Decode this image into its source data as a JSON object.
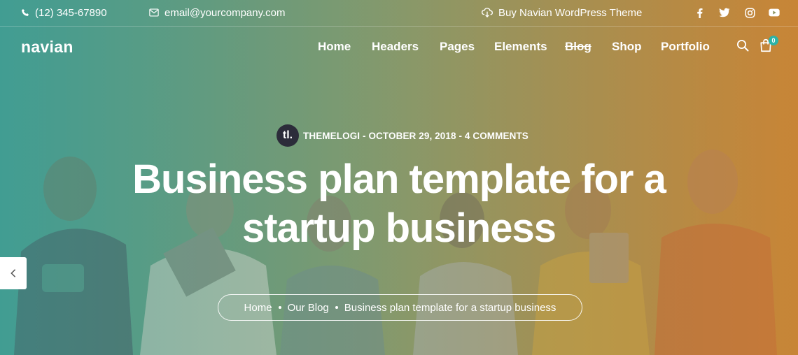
{
  "topbar": {
    "phone": "(12) 345-67890",
    "email": "email@yourcompany.com",
    "buy_link": "Buy Navian WordPress Theme",
    "social": [
      "facebook-icon",
      "twitter-icon",
      "instagram-icon",
      "youtube-icon"
    ]
  },
  "brand": {
    "logo": "navian"
  },
  "nav": {
    "items": [
      {
        "label": "Home"
      },
      {
        "label": "Headers"
      },
      {
        "label": "Pages"
      },
      {
        "label": "Elements"
      },
      {
        "label": "Blog"
      },
      {
        "label": "Shop"
      },
      {
        "label": "Portfolio"
      }
    ],
    "cart_count": "0"
  },
  "post": {
    "avatar_initials": "tl.",
    "meta": "THEMELOGI - OCTOBER 29, 2018 - 4 COMMENTS",
    "title_line1": "Business plan template for a",
    "title_line2": "startup business"
  },
  "breadcrumb": {
    "items": [
      "Home",
      "Our Blog",
      "Business plan template for a startup business"
    ]
  },
  "colors": {
    "gradient_left": "#3f9a8f",
    "gradient_right": "#c08236",
    "badge": "#2bb3a8",
    "avatar_bg": "#2c2c3a"
  }
}
